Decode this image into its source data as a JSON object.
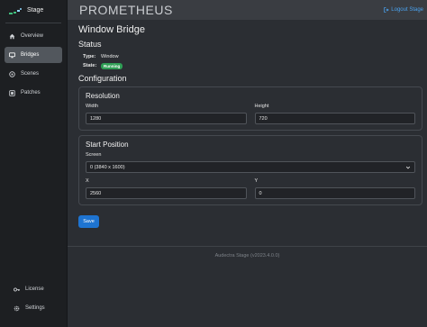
{
  "sidebar": {
    "brand": "Stage",
    "items": [
      {
        "label": "Overview",
        "icon": "home-icon",
        "active": false
      },
      {
        "label": "Bridges",
        "icon": "monitor-icon",
        "active": true
      },
      {
        "label": "Scenes",
        "icon": "scenes-icon",
        "active": false
      },
      {
        "label": "Patches",
        "icon": "patches-icon",
        "active": false
      }
    ],
    "bottom_items": [
      {
        "label": "License",
        "icon": "key-icon"
      },
      {
        "label": "Settings",
        "icon": "gear-icon"
      }
    ]
  },
  "header": {
    "title": "PROMETHEUS",
    "logout_label": "Logout Stage"
  },
  "main": {
    "page_title": "Window Bridge",
    "status": {
      "title": "Status",
      "type_key": "Type:",
      "type_value": "Window",
      "state_key": "State:",
      "state_value": "Running"
    },
    "configuration": {
      "title": "Configuration",
      "resolution": {
        "title": "Resolution",
        "width_label": "Width",
        "width_value": "1280",
        "height_label": "Height",
        "height_value": "720"
      },
      "start_position": {
        "title": "Start Position",
        "screen_label": "Screen",
        "screen_value": "0 (3840 x 1600)",
        "x_label": "X",
        "x_value": "2560",
        "y_label": "Y",
        "y_value": "0"
      }
    },
    "save_label": "Save"
  },
  "footer": {
    "text": "Audectra Stage (v2023.4.0.0)"
  },
  "colors": {
    "accent": "#1e74d1",
    "running_badge": "#2f9e55",
    "link": "#4aa3f0"
  }
}
